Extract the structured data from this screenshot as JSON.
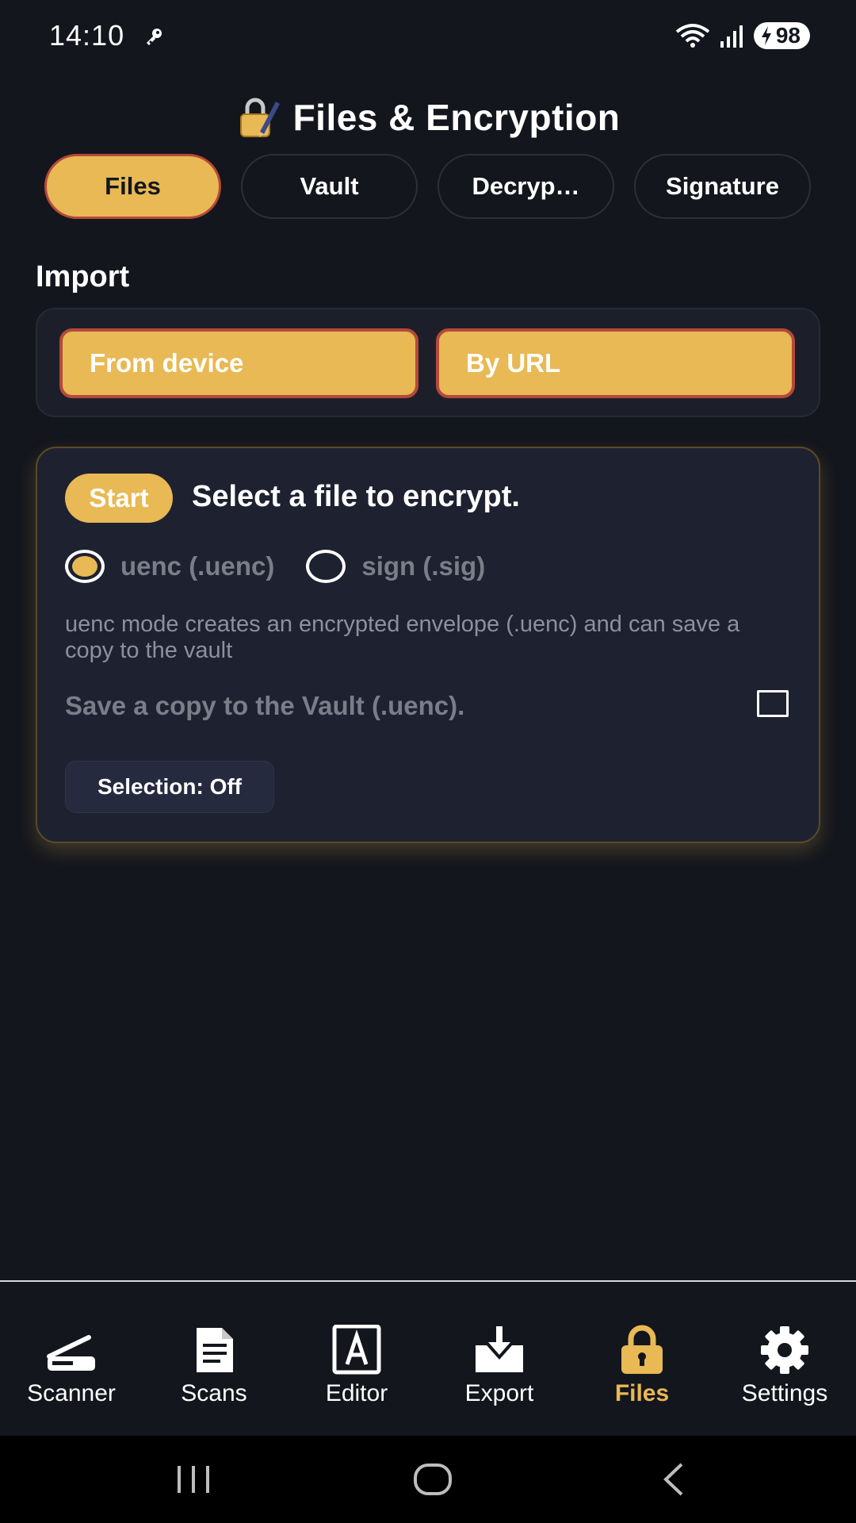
{
  "status_bar": {
    "time": "14:10",
    "battery": "98",
    "icons": [
      "key-icon",
      "wifi-icon",
      "signal-icon",
      "battery-charging-icon"
    ]
  },
  "header": {
    "icon": "lock-with-pen-icon",
    "title": "Files & Encryption"
  },
  "tabs": [
    {
      "label": "Files",
      "active": true
    },
    {
      "label": "Vault",
      "active": false
    },
    {
      "label": "Decryp…",
      "active": false
    },
    {
      "label": "Signature",
      "active": false
    }
  ],
  "import": {
    "title": "Import",
    "from_device": "From device",
    "by_url": "By URL"
  },
  "start_card": {
    "badge": "Start",
    "title": "Select a file to encrypt.",
    "radio_options": [
      {
        "label": "uenc (.uenc)",
        "selected": true
      },
      {
        "label": "sign (.sig)",
        "selected": false
      }
    ],
    "description": "uenc mode creates an encrypted envelope (.uenc) and can save a copy to the vault",
    "vault_copy_label": "Save a copy to the Vault (.uenc).",
    "vault_copy_checked": false,
    "selection_chip": "Selection: Off"
  },
  "bottom_nav": [
    {
      "label": "Scanner",
      "icon": "scanner-icon",
      "active": false
    },
    {
      "label": "Scans",
      "icon": "document-icon",
      "active": false
    },
    {
      "label": "Editor",
      "icon": "text-box-icon",
      "active": false
    },
    {
      "label": "Export",
      "icon": "export-tray-icon",
      "active": false
    },
    {
      "label": "Files",
      "icon": "lock-icon",
      "active": true
    },
    {
      "label": "Settings",
      "icon": "gear-icon",
      "active": false
    }
  ],
  "system_nav": [
    "recent-apps-icon",
    "home-icon",
    "back-icon"
  ],
  "colors": {
    "background": "#14161d",
    "accent": "#e8b954",
    "accent_border": "#b5493a",
    "card": "#1e2130",
    "muted_text": "#7a7e89"
  }
}
